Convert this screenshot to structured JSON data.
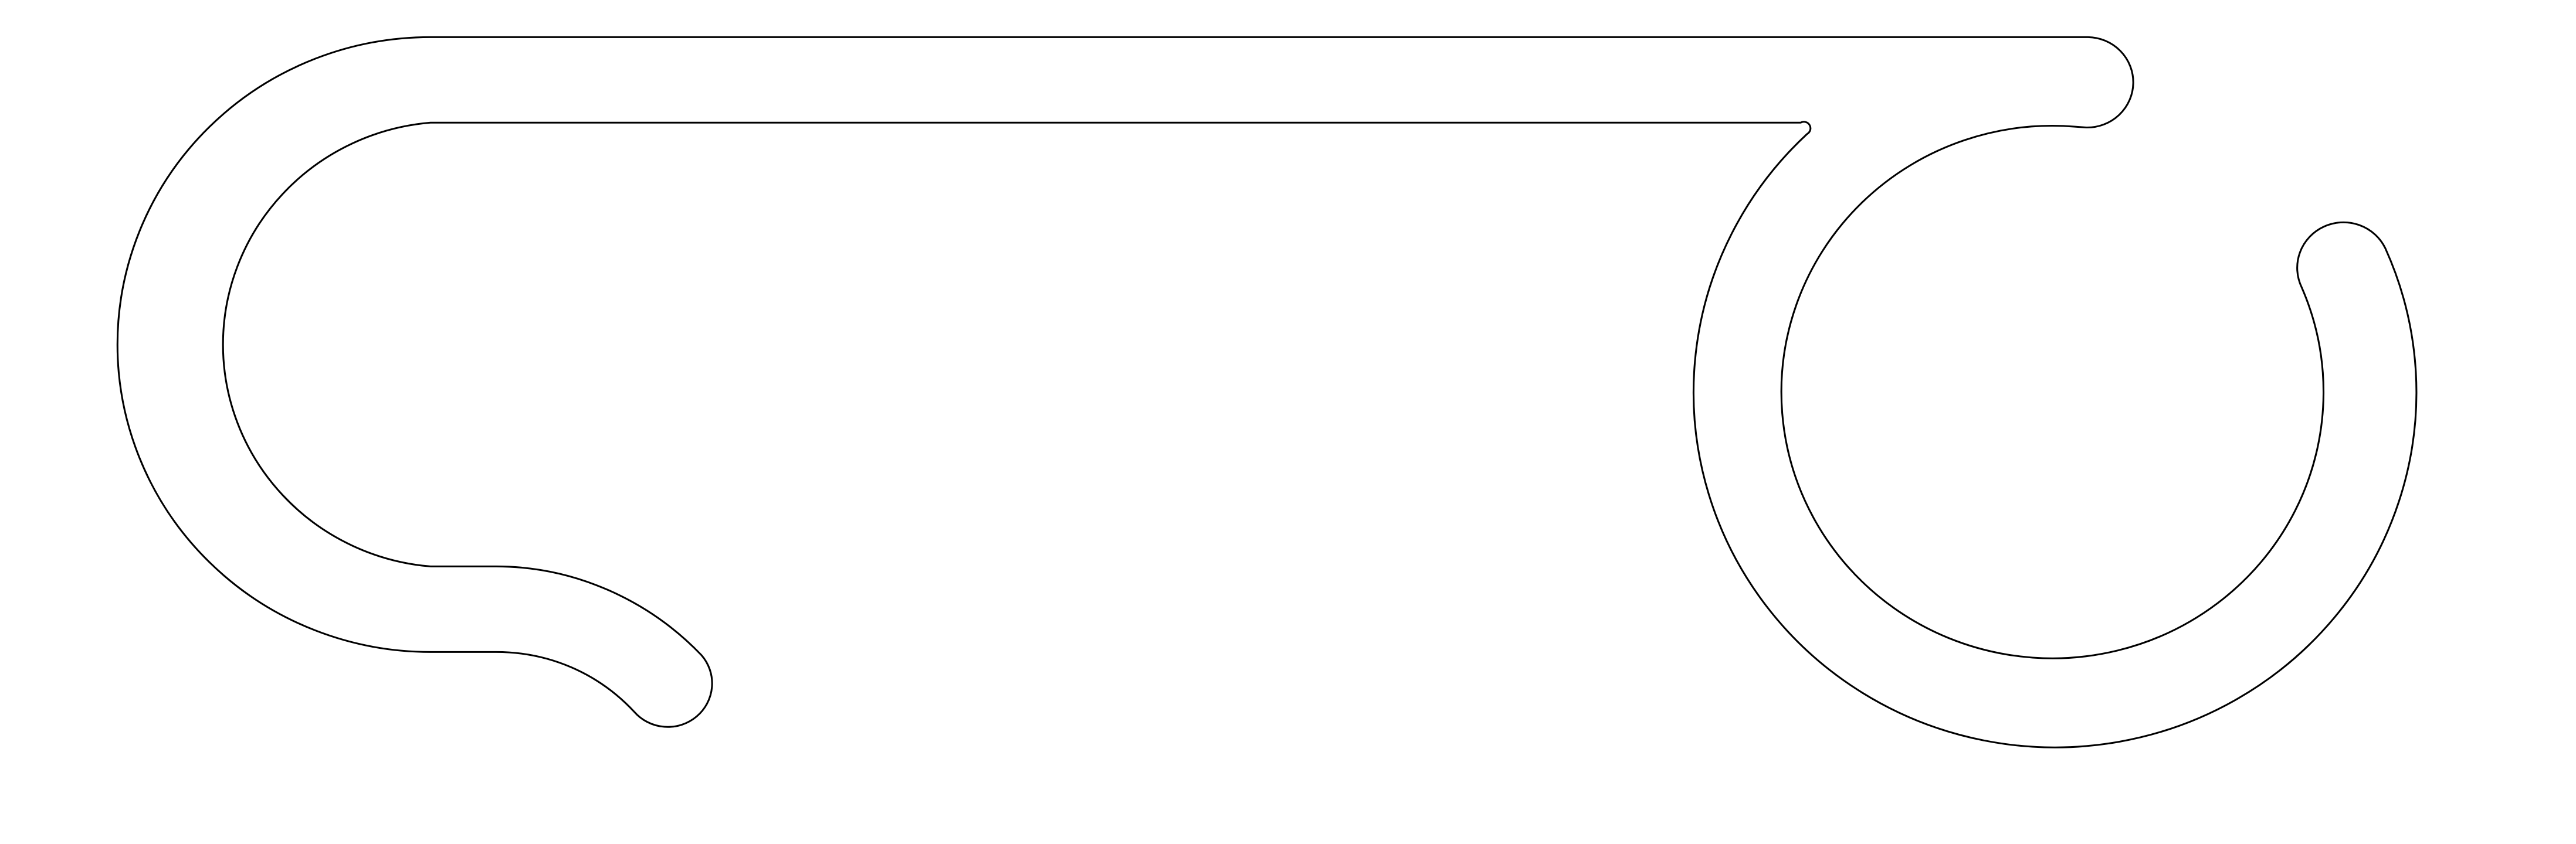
{
  "drawing": {
    "shape": "curved-hook-outline",
    "background_color": "#ffffff",
    "stroke_color": "#000000",
    "fill": "none",
    "text_labels": []
  }
}
